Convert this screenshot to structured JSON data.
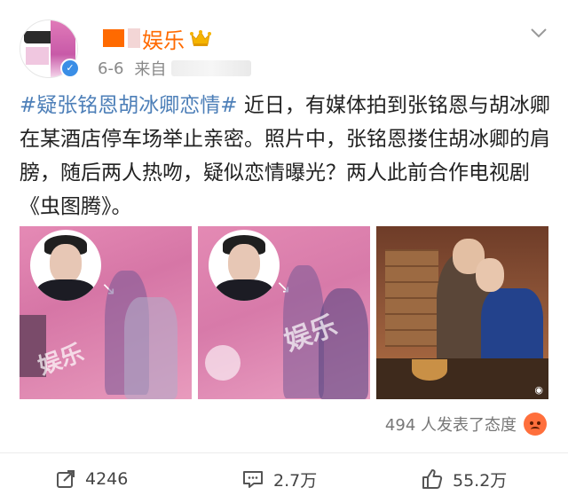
{
  "post": {
    "author_name": "娱乐",
    "date": "6-6",
    "source_prefix": "来自",
    "tag": "#疑张铭恩胡冰卿恋情#",
    "body": "近日，有媒体拍到张铭恩与胡冰卿在某酒店停车场举止亲密。照片中，张铭恩搂住胡冰卿的肩膀，随后两人热吻，疑似恋情曝光？两人此前合作电视剧《虫图腾》。",
    "watermark_text": "娱乐",
    "reactions_text": "494 人发表了态度"
  },
  "actions": {
    "repost_count": "4246",
    "comment_count": "2.7万",
    "like_count": "55.2万"
  },
  "icons": {
    "verified": "verified-badge-icon",
    "crown": "crown-icon",
    "more": "chevron-down-icon",
    "repost": "repost-icon",
    "comment": "comment-icon",
    "like": "thumbs-up-icon",
    "reaction": "angry-emoji-icon"
  },
  "colors": {
    "author": "#ff6a00",
    "tag": "#4d7fb8",
    "verified": "#3a8ee6",
    "meta": "#888888"
  }
}
